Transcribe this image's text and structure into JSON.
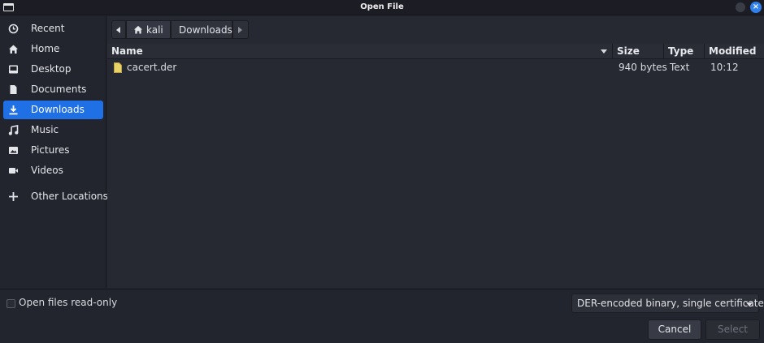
{
  "window": {
    "title": "Open File",
    "close_glyph": "×"
  },
  "sidebar": {
    "items": [
      {
        "label": "Recent",
        "icon": "clock-icon",
        "active": false
      },
      {
        "label": "Home",
        "icon": "home-icon",
        "active": false
      },
      {
        "label": "Desktop",
        "icon": "desktop-icon",
        "active": false
      },
      {
        "label": "Documents",
        "icon": "document-icon",
        "active": false
      },
      {
        "label": "Downloads",
        "icon": "download-icon",
        "active": true
      },
      {
        "label": "Music",
        "icon": "music-icon",
        "active": false
      },
      {
        "label": "Pictures",
        "icon": "picture-icon",
        "active": false
      },
      {
        "label": "Videos",
        "icon": "video-icon",
        "active": false
      },
      {
        "label": "Other Locations",
        "icon": "plus-icon",
        "active": false
      }
    ]
  },
  "path_bar": {
    "home": "kali",
    "current": "Downloads"
  },
  "columns": {
    "name": "Name",
    "size": "Size",
    "type": "Type",
    "modified": "Modified"
  },
  "files": [
    {
      "name": "cacert.der",
      "size": "940 bytes",
      "type": "Text",
      "modified": "10:12",
      "icon": "file-icon"
    }
  ],
  "footer": {
    "readonly_label": "Open files read-only",
    "readonly_checked": false,
    "filter_value": "DER-encoded binary, single certificate",
    "cancel_label": "Cancel",
    "select_label": "Select"
  },
  "colors": {
    "accent": "#1f6fe5",
    "background": "#23252e",
    "file_icon": "#e8d36a"
  }
}
